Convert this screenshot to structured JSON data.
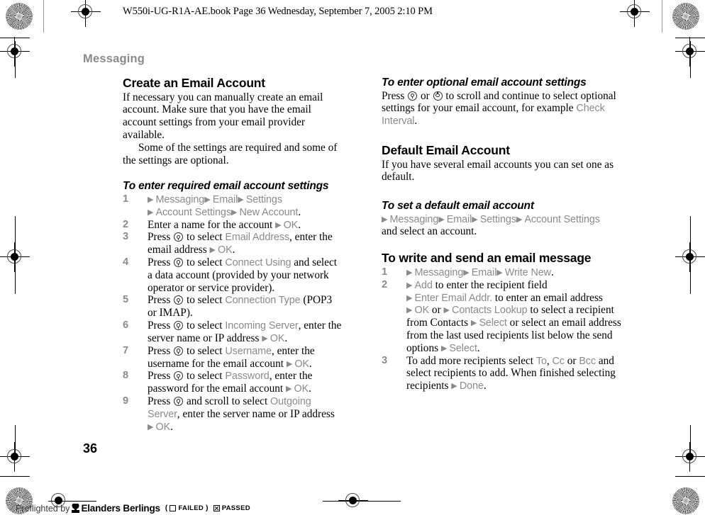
{
  "header": {
    "file_line": "W550i-UG-R1A-AE.book  Page 36  Wednesday, September 7, 2005  2:10 PM"
  },
  "running_head": "Messaging",
  "page_number": "36",
  "colors": {
    "ui_term_gray": "#8a8a8a",
    "body_black": "#000000",
    "running_head_gray": "#8a8a8a"
  },
  "icons": {
    "navkey_down": "navigation-key-down-icon",
    "navkey_up": "navigation-key-up-icon",
    "arrow": "▶"
  },
  "left_column": {
    "heading": "Create an Email Account",
    "intro_1": "If necessary you can manually create an email account. Make sure that you have the email account settings from your email provider available.",
    "intro_2": "Some of the settings are required and some of the settings are optional.",
    "procedure_title": "To enter required email account settings",
    "steps": [
      {
        "num": "1",
        "parts": [
          {
            "t": "arrow"
          },
          {
            "t": "ui",
            "v": "Messaging"
          },
          {
            "t": "arrow"
          },
          {
            "t": "ui",
            "v": "Email"
          },
          {
            "t": "arrow"
          },
          {
            "t": "ui",
            "v": "Settings"
          },
          {
            "t": "br"
          },
          {
            "t": "arrow"
          },
          {
            "t": "ui",
            "v": "Account Settings"
          },
          {
            "t": "arrow"
          },
          {
            "t": "ui",
            "v": "New Account"
          },
          {
            "t": "txt",
            "v": "."
          }
        ]
      },
      {
        "num": "2",
        "parts": [
          {
            "t": "txt",
            "v": "Enter a name for the account "
          },
          {
            "t": "arrow"
          },
          {
            "t": "ui",
            "v": "OK"
          },
          {
            "t": "txt",
            "v": "."
          }
        ]
      },
      {
        "num": "3",
        "parts": [
          {
            "t": "txt",
            "v": "Press "
          },
          {
            "t": "navkey"
          },
          {
            "t": "txt",
            "v": " to select "
          },
          {
            "t": "ui",
            "v": "Email Address"
          },
          {
            "t": "txt",
            "v": ", enter the email address "
          },
          {
            "t": "arrow"
          },
          {
            "t": "ui",
            "v": "OK"
          },
          {
            "t": "txt",
            "v": "."
          }
        ]
      },
      {
        "num": "4",
        "parts": [
          {
            "t": "txt",
            "v": "Press "
          },
          {
            "t": "navkey"
          },
          {
            "t": "txt",
            "v": " to select "
          },
          {
            "t": "ui",
            "v": "Connect Using"
          },
          {
            "t": "txt",
            "v": " and select a data account (provided by your network operator or service provider)."
          }
        ]
      },
      {
        "num": "5",
        "parts": [
          {
            "t": "txt",
            "v": "Press "
          },
          {
            "t": "navkey"
          },
          {
            "t": "txt",
            "v": " to select "
          },
          {
            "t": "ui",
            "v": "Connection Type"
          },
          {
            "t": "txt",
            "v": " (POP3 or IMAP)."
          }
        ]
      },
      {
        "num": "6",
        "parts": [
          {
            "t": "txt",
            "v": "Press "
          },
          {
            "t": "navkey"
          },
          {
            "t": "txt",
            "v": " to select "
          },
          {
            "t": "ui",
            "v": "Incoming Server"
          },
          {
            "t": "txt",
            "v": ", enter the server name or IP address "
          },
          {
            "t": "arrow"
          },
          {
            "t": "ui",
            "v": "OK"
          },
          {
            "t": "txt",
            "v": "."
          }
        ]
      },
      {
        "num": "7",
        "parts": [
          {
            "t": "txt",
            "v": "Press "
          },
          {
            "t": "navkey"
          },
          {
            "t": "txt",
            "v": " to select "
          },
          {
            "t": "ui",
            "v": "Username"
          },
          {
            "t": "txt",
            "v": ", enter the username for the email account "
          },
          {
            "t": "arrow"
          },
          {
            "t": "ui",
            "v": "OK"
          },
          {
            "t": "txt",
            "v": "."
          }
        ]
      },
      {
        "num": "8",
        "parts": [
          {
            "t": "txt",
            "v": "Press "
          },
          {
            "t": "navkey"
          },
          {
            "t": "txt",
            "v": " to select "
          },
          {
            "t": "ui",
            "v": "Password"
          },
          {
            "t": "txt",
            "v": ", enter the password for the email account "
          },
          {
            "t": "arrow"
          },
          {
            "t": "ui",
            "v": "OK"
          },
          {
            "t": "txt",
            "v": "."
          }
        ]
      },
      {
        "num": "9",
        "parts": [
          {
            "t": "txt",
            "v": "Press "
          },
          {
            "t": "navkey"
          },
          {
            "t": "txt",
            "v": " and scroll to select "
          },
          {
            "t": "ui",
            "v": "Outgoing Server"
          },
          {
            "t": "txt",
            "v": ", enter the server name or IP address "
          },
          {
            "t": "arrow"
          },
          {
            "t": "ui",
            "v": "OK"
          },
          {
            "t": "txt",
            "v": "."
          }
        ]
      }
    ]
  },
  "right_column": {
    "optional_title": "To enter optional email account settings",
    "optional_body_parts": [
      {
        "t": "txt",
        "v": "Press "
      },
      {
        "t": "navkey"
      },
      {
        "t": "txt",
        "v": " or "
      },
      {
        "t": "navkey_up"
      },
      {
        "t": "txt",
        "v": " to scroll and continue to select optional settings for your email account, for example "
      },
      {
        "t": "ui",
        "v": "Check Interval"
      },
      {
        "t": "txt",
        "v": "."
      }
    ],
    "default_heading": "Default Email Account",
    "default_body": "If you have several email accounts you can set one as default.",
    "set_default_title": "To set a default email account",
    "set_default_parts": [
      {
        "t": "arrow"
      },
      {
        "t": "ui",
        "v": "Messaging"
      },
      {
        "t": "arrow"
      },
      {
        "t": "ui",
        "v": "Email"
      },
      {
        "t": "arrow"
      },
      {
        "t": "ui",
        "v": "Settings"
      },
      {
        "t": "arrow"
      },
      {
        "t": "ui",
        "v": "Account Settings"
      },
      {
        "t": "br"
      },
      {
        "t": "txt",
        "v": "and select an account."
      }
    ],
    "write_send_title": "To write and send an email message",
    "write_send_steps": [
      {
        "num": "1",
        "parts": [
          {
            "t": "arrow"
          },
          {
            "t": "ui",
            "v": "Messaging"
          },
          {
            "t": "arrow"
          },
          {
            "t": "ui",
            "v": "Email"
          },
          {
            "t": "arrow"
          },
          {
            "t": "ui",
            "v": "Write New"
          },
          {
            "t": "txt",
            "v": "."
          }
        ]
      },
      {
        "num": "2",
        "parts": [
          {
            "t": "arrow"
          },
          {
            "t": "ui",
            "v": "Add"
          },
          {
            "t": "txt",
            "v": " to enter the recipient field"
          },
          {
            "t": "br"
          },
          {
            "t": "arrow"
          },
          {
            "t": "ui",
            "v": "Enter Email Addr."
          },
          {
            "t": "txt",
            "v": " to enter an email address"
          },
          {
            "t": "br"
          },
          {
            "t": "arrow"
          },
          {
            "t": "ui",
            "v": "OK"
          },
          {
            "t": "txt",
            "v": " or "
          },
          {
            "t": "arrow"
          },
          {
            "t": "ui",
            "v": "Contacts Lookup"
          },
          {
            "t": "txt",
            "v": " to select a recipient from Contacts "
          },
          {
            "t": "arrow"
          },
          {
            "t": "ui",
            "v": "Select"
          },
          {
            "t": "txt",
            "v": " or select an email address from the last used recipients list below the send options "
          },
          {
            "t": "arrow"
          },
          {
            "t": "ui",
            "v": "Select"
          },
          {
            "t": "txt",
            "v": "."
          }
        ]
      },
      {
        "num": "3",
        "parts": [
          {
            "t": "txt",
            "v": "To add more recipients select "
          },
          {
            "t": "ui",
            "v": "To"
          },
          {
            "t": "txt",
            "v": ", "
          },
          {
            "t": "ui",
            "v": "Cc"
          },
          {
            "t": "txt",
            "v": " or "
          },
          {
            "t": "ui",
            "v": "Bcc"
          },
          {
            "t": "txt",
            "v": " and select recipients to add. When finished selecting recipients "
          },
          {
            "t": "arrow"
          },
          {
            "t": "ui",
            "v": "Done"
          },
          {
            "t": "txt",
            "v": "."
          }
        ]
      }
    ]
  },
  "preflight": {
    "prefix": "Preflighted by",
    "brand": "Elanders Berlings",
    "open_paren": "(",
    "failed_label": "FAILED",
    "close_paren": ")",
    "passed_label": "PASSED"
  }
}
